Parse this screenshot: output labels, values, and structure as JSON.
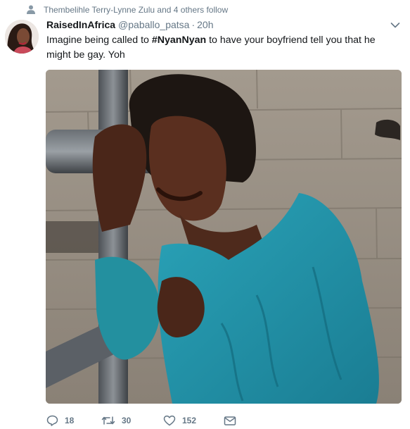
{
  "social_context": {
    "text": "Thembelihle Terry-Lynne Zulu and 4 others follow",
    "icon": "person-icon"
  },
  "tweet": {
    "author_name": "RaisedInAfrica",
    "author_handle": "@paballo_patsa",
    "separator": "·",
    "time": "20h",
    "text_before": "Imagine being called to ",
    "hashtag": "#NyanNyan",
    "text_after": " to have your boyfriend tell you that he might be gay. Yoh"
  },
  "actions": {
    "reply_count": "18",
    "retweet_count": "30",
    "like_count": "152"
  },
  "colors": {
    "secondary_text": "#657786",
    "primary_text": "#14171a",
    "shirt_teal": "#1f8fa6"
  }
}
